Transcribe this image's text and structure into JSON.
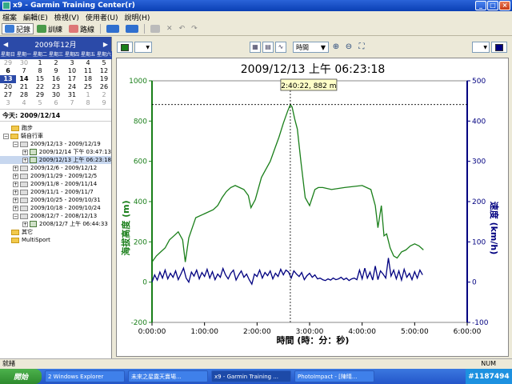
{
  "window": {
    "title": "x9 - Garmin Training Center(r)"
  },
  "menu": [
    "檔案",
    "編輯(E)",
    "檢視(V)",
    "使用者(U)",
    "說明(H)"
  ],
  "toolbar": {
    "history_label": "記錄",
    "training_label": "訓練",
    "courses_label": "路線"
  },
  "calendar": {
    "month_label": "2009年12月",
    "dow": [
      "星期日",
      "星期一",
      "星期二",
      "星期三",
      "星期四",
      "星期五",
      "星期六"
    ],
    "weeks": [
      [
        "29",
        "30",
        "1",
        "2",
        "3",
        "4",
        "5"
      ],
      [
        "6",
        "7",
        "8",
        "9",
        "10",
        "11",
        "12"
      ],
      [
        "13",
        "14",
        "15",
        "16",
        "17",
        "18",
        "19"
      ],
      [
        "20",
        "21",
        "22",
        "23",
        "24",
        "25",
        "26"
      ],
      [
        "27",
        "28",
        "29",
        "30",
        "31",
        "1",
        "2"
      ],
      [
        "3",
        "4",
        "5",
        "6",
        "7",
        "8",
        "9"
      ]
    ],
    "today_label": "今天: 2009/12/14"
  },
  "tree": {
    "running": "跑步",
    "biking": "騎自行車",
    "week1": "2009/12/13 - 2009/12/19",
    "act1": "2009/12/14 下午 03:47:13",
    "act2": "2009/12/13 上午 06:23:18",
    "weeks": [
      "2009/12/6 - 2009/12/12",
      "2009/11/29 - 2009/12/5",
      "2009/11/8 - 2009/11/14",
      "2009/11/1 - 2009/11/7",
      "2009/10/25 - 2009/10/31",
      "2009/10/18 - 2009/10/24"
    ],
    "week_last": "2008/12/7 - 2008/12/13",
    "act3": "2008/12/7 上午 06:44:33",
    "other": "其它",
    "multisport": "MultiSport"
  },
  "chart_toolbar": {
    "xaxis_select": "時間",
    "series_color_left": "#1a7f1a",
    "series_color_right": "#000080"
  },
  "chart_data": {
    "type": "line",
    "title": "2009/12/13 上午 06:23:18",
    "xlabel": "時間 (時：分：秒)",
    "ylabel_left": "海拔高度 (m)",
    "ylabel_right": "速度 (km/h)",
    "x_ticks": [
      "0:00:00",
      "1:00:00",
      "2:00:00",
      "3:00:00",
      "4:00:00",
      "5:00:00",
      "6:00:00"
    ],
    "y_left_ticks": [
      "-200",
      "0",
      "200",
      "400",
      "600",
      "800",
      "1000"
    ],
    "y_right_ticks": [
      "-100",
      "0",
      "100",
      "200",
      "300",
      "400",
      "500"
    ],
    "xlim_min": [
      0,
      360
    ],
    "ylim_left": [
      -200,
      1000
    ],
    "ylim_right": [
      -100,
      500
    ],
    "tooltip": "2:40:22, 882 m",
    "series": [
      {
        "name": "海拔高度",
        "axis": "left",
        "color": "#1a7f1a",
        "x": [
          0,
          5,
          10,
          15,
          20,
          25,
          30,
          35,
          38,
          42,
          50,
          60,
          70,
          75,
          80,
          85,
          90,
          95,
          100,
          105,
          110,
          113,
          118,
          125,
          130,
          135,
          140,
          145,
          150,
          155,
          158,
          160,
          163,
          166,
          170,
          175,
          180,
          183,
          186,
          190,
          195,
          205,
          220,
          240,
          250,
          255,
          258,
          262,
          265,
          268,
          272,
          276,
          280,
          285,
          290,
          295,
          300,
          305,
          310
        ],
        "y": [
          100,
          130,
          150,
          170,
          210,
          230,
          250,
          210,
          100,
          220,
          320,
          340,
          360,
          380,
          420,
          450,
          470,
          480,
          470,
          460,
          430,
          370,
          410,
          520,
          560,
          600,
          660,
          720,
          790,
          850,
          882,
          870,
          810,
          760,
          600,
          420,
          380,
          420,
          460,
          470,
          470,
          460,
          470,
          480,
          460,
          380,
          270,
          380,
          230,
          240,
          170,
          130,
          120,
          150,
          160,
          180,
          190,
          180,
          160
        ]
      },
      {
        "name": "速度",
        "axis": "right",
        "color": "#000080",
        "x": [
          0,
          3,
          6,
          9,
          12,
          15,
          18,
          21,
          24,
          27,
          30,
          33,
          36,
          39,
          42,
          45,
          48,
          51,
          54,
          57,
          60,
          63,
          66,
          69,
          72,
          75,
          78,
          81,
          84,
          87,
          90,
          93,
          96,
          99,
          102,
          105,
          108,
          111,
          114,
          117,
          120,
          123,
          126,
          129,
          132,
          135,
          138,
          141,
          144,
          147,
          150,
          153,
          156,
          159,
          162,
          165,
          168,
          171,
          174,
          177,
          180,
          183,
          186,
          189,
          192,
          195,
          198,
          201,
          204,
          207,
          210,
          213,
          216,
          219,
          222,
          225,
          228,
          231,
          234,
          237,
          240,
          243,
          246,
          249,
          252,
          255,
          258,
          261,
          264,
          267,
          270,
          273,
          276,
          279,
          282,
          285,
          288,
          291,
          294,
          297,
          300,
          303,
          306,
          309
        ],
        "y": [
          0,
          18,
          5,
          25,
          10,
          30,
          8,
          22,
          12,
          28,
          6,
          20,
          35,
          10,
          0,
          25,
          15,
          30,
          8,
          24,
          14,
          32,
          10,
          26,
          6,
          20,
          12,
          34,
          18,
          8,
          22,
          30,
          5,
          18,
          28,
          12,
          20,
          6,
          -5,
          20,
          14,
          30,
          10,
          24,
          16,
          28,
          8,
          22,
          14,
          32,
          18,
          30,
          25,
          10,
          28,
          20,
          14,
          24,
          6,
          16,
          22,
          12,
          18,
          8,
          10,
          6,
          4,
          8,
          5,
          10,
          6,
          8,
          12,
          6,
          10,
          4,
          8,
          10,
          6,
          30,
          8,
          35,
          10,
          25,
          5,
          40,
          6,
          28,
          20,
          10,
          60,
          15,
          30,
          8,
          28,
          5,
          32,
          12,
          22,
          6,
          26,
          10,
          30,
          18
        ]
      }
    ]
  },
  "status": {
    "left": "就緒",
    "right": "NUM"
  },
  "taskbar": {
    "start": "開始",
    "items": [
      "2 Windows Explorer",
      "未來之星露天賣場...",
      "x9 - Garmin Training ...",
      "PhotoImpact - [陳晴..."
    ],
    "tray": "#1187494"
  }
}
